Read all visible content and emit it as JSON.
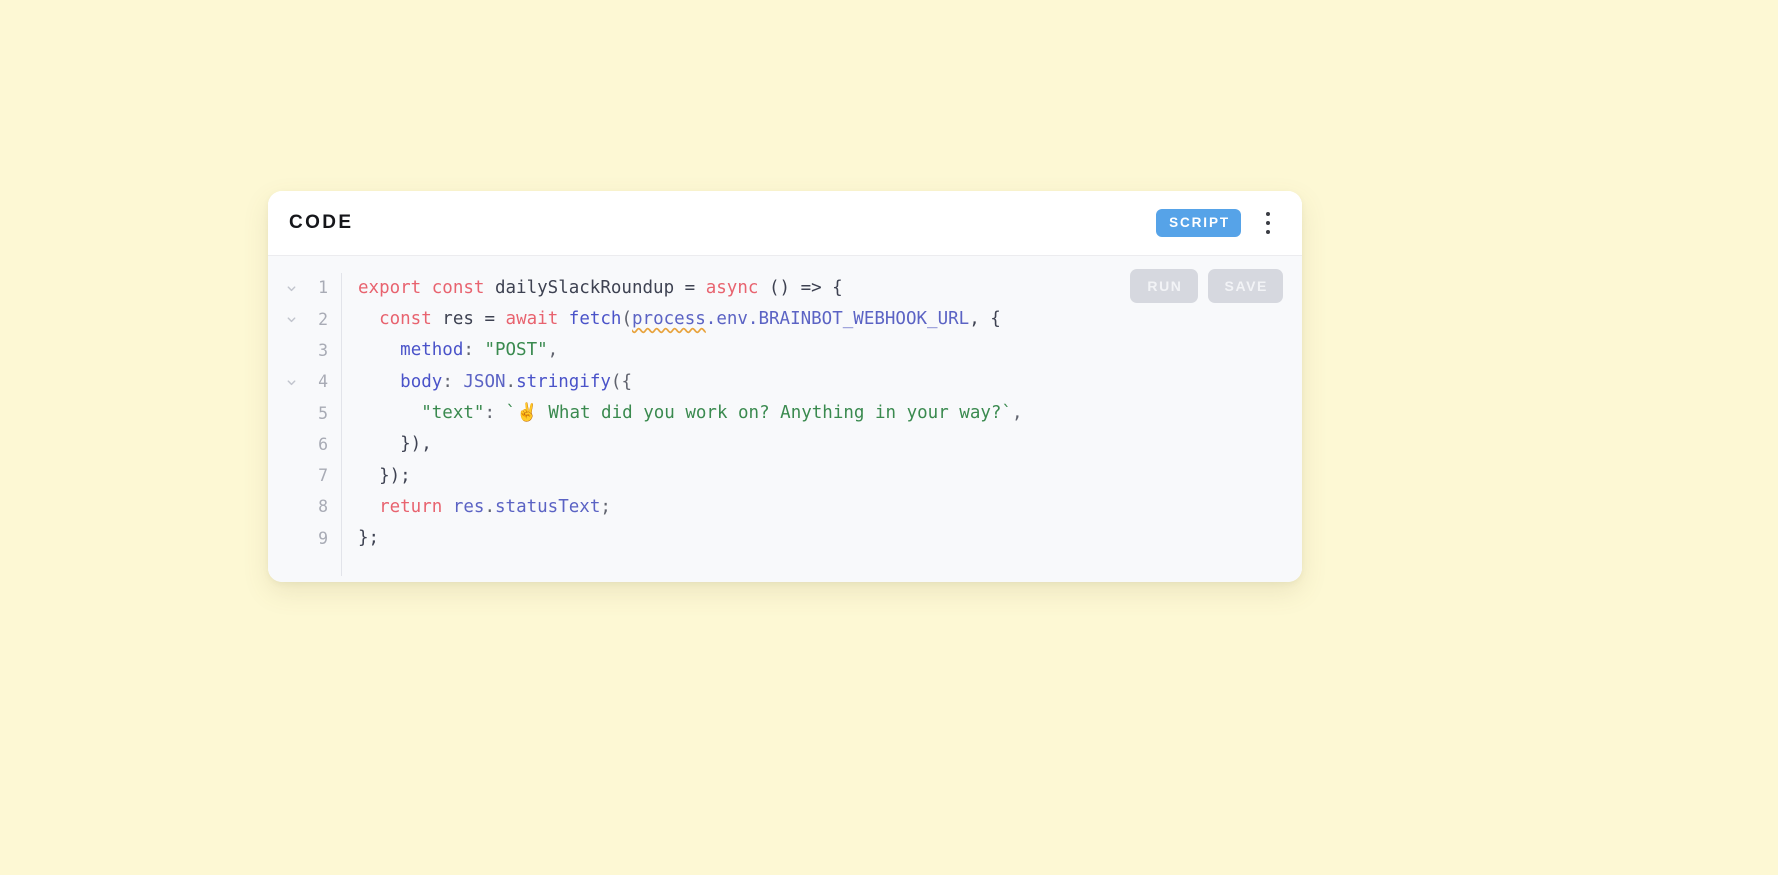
{
  "page": {
    "background_color": "#fdf8d4"
  },
  "card": {
    "header": {
      "title": "CODE",
      "badge_label": "SCRIPT",
      "badge_color": "#56a3e8",
      "menu_icon": "kebab-menu-icon"
    },
    "actions": {
      "run_label": "RUN",
      "save_label": "SAVE"
    },
    "editor": {
      "language": "javascript",
      "lines": [
        {
          "number": "1",
          "foldable": true,
          "tokens": [
            {
              "text": "export",
              "type": "keyword"
            },
            {
              "text": " ",
              "type": "plain"
            },
            {
              "text": "const",
              "type": "keyword"
            },
            {
              "text": " dailySlackRoundup ",
              "type": "plain"
            },
            {
              "text": "=",
              "type": "plain"
            },
            {
              "text": " ",
              "type": "plain"
            },
            {
              "text": "async",
              "type": "keyword"
            },
            {
              "text": " () => {",
              "type": "plain"
            }
          ]
        },
        {
          "number": "2",
          "foldable": true,
          "tokens": [
            {
              "text": "  ",
              "type": "plain"
            },
            {
              "text": "const",
              "type": "keyword"
            },
            {
              "text": " res ",
              "type": "plain"
            },
            {
              "text": "=",
              "type": "plain"
            },
            {
              "text": " ",
              "type": "plain"
            },
            {
              "text": "await",
              "type": "keyword"
            },
            {
              "text": " ",
              "type": "plain"
            },
            {
              "text": "fetch",
              "type": "function"
            },
            {
              "text": "(",
              "type": "punct"
            },
            {
              "text": "process",
              "type": "variable-error"
            },
            {
              "text": ".env.BRAINBOT_WEBHOOK_URL",
              "type": "variable"
            },
            {
              "text": ", {",
              "type": "plain"
            }
          ]
        },
        {
          "number": "3",
          "foldable": false,
          "tokens": [
            {
              "text": "    ",
              "type": "plain"
            },
            {
              "text": "method",
              "type": "property"
            },
            {
              "text": ": ",
              "type": "punct"
            },
            {
              "text": "\"POST\"",
              "type": "string"
            },
            {
              "text": ",",
              "type": "punct"
            }
          ]
        },
        {
          "number": "4",
          "foldable": true,
          "tokens": [
            {
              "text": "    ",
              "type": "plain"
            },
            {
              "text": "body",
              "type": "property"
            },
            {
              "text": ": ",
              "type": "punct"
            },
            {
              "text": "JSON",
              "type": "variable"
            },
            {
              "text": ".",
              "type": "punct"
            },
            {
              "text": "stringify",
              "type": "function"
            },
            {
              "text": "({",
              "type": "punct"
            }
          ]
        },
        {
          "number": "5",
          "foldable": false,
          "tokens": [
            {
              "text": "      ",
              "type": "plain"
            },
            {
              "text": "\"text\"",
              "type": "string"
            },
            {
              "text": ": ",
              "type": "punct"
            },
            {
              "text": "`✌️ What did you work on? Anything in your way?`",
              "type": "string"
            },
            {
              "text": ",",
              "type": "punct"
            }
          ]
        },
        {
          "number": "6",
          "foldable": false,
          "tokens": [
            {
              "text": "    }),",
              "type": "plain"
            }
          ]
        },
        {
          "number": "7",
          "foldable": false,
          "tokens": [
            {
              "text": "  });",
              "type": "plain"
            }
          ]
        },
        {
          "number": "8",
          "foldable": false,
          "tokens": [
            {
              "text": "  ",
              "type": "plain"
            },
            {
              "text": "return",
              "type": "keyword"
            },
            {
              "text": " ",
              "type": "plain"
            },
            {
              "text": "res",
              "type": "variable"
            },
            {
              "text": ".",
              "type": "punct"
            },
            {
              "text": "statusText",
              "type": "variable"
            },
            {
              "text": ";",
              "type": "punct"
            }
          ]
        },
        {
          "number": "9",
          "foldable": false,
          "tokens": [
            {
              "text": "};",
              "type": "plain"
            }
          ]
        }
      ]
    }
  }
}
